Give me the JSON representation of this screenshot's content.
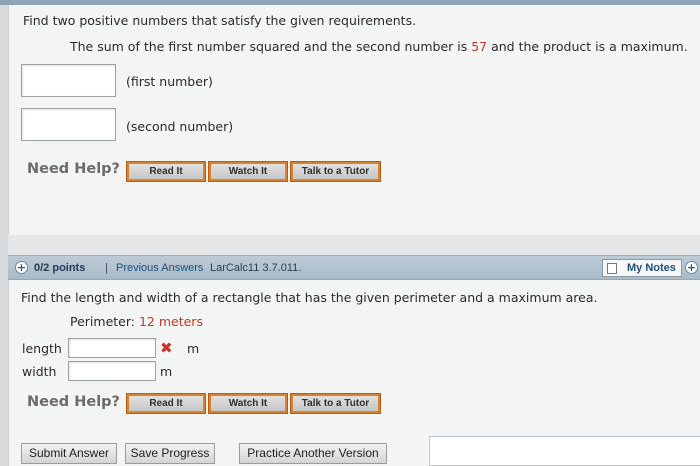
{
  "question1": {
    "prompt": "Find two positive numbers that satisfy the given requirements.",
    "requirement_before": "The sum of the first number squared and the second number is ",
    "requirement_value": "57",
    "requirement_after": " and the product is a maximum.",
    "fields": [
      {
        "label": "(first number)",
        "value": ""
      },
      {
        "label": "(second number)",
        "value": ""
      }
    ],
    "need_help": "Need Help?",
    "buttons": [
      "Read It",
      "Watch It",
      "Talk to a Tutor"
    ]
  },
  "question2": {
    "header": {
      "points": "0/2 points",
      "separator": "|",
      "previous_answers": "Previous Answers",
      "course_code": "LarCalc11 3.7.011.",
      "my_notes": "My Notes"
    },
    "prompt": "Find the length and width of a rectangle that has the given perimeter and a maximum area.",
    "perimeter_label": "Perimeter: ",
    "perimeter_value": "12 meters",
    "fields": [
      {
        "label": "length",
        "value": "",
        "unit": "m",
        "status": "incorrect"
      },
      {
        "label": "width",
        "value": "",
        "unit": "m",
        "status": ""
      }
    ],
    "need_help": "Need Help?",
    "buttons": [
      "Read It",
      "Watch It",
      "Talk to a Tutor"
    ]
  },
  "actions": {
    "submit": "Submit Answer",
    "save": "Save Progress",
    "practice": "Practice Another Version"
  },
  "colors": {
    "header_bar": "#a9bbc9",
    "help_button_border": "#d9822b",
    "incorrect": "#d32f2f",
    "highlight_value": "#c0392b"
  }
}
